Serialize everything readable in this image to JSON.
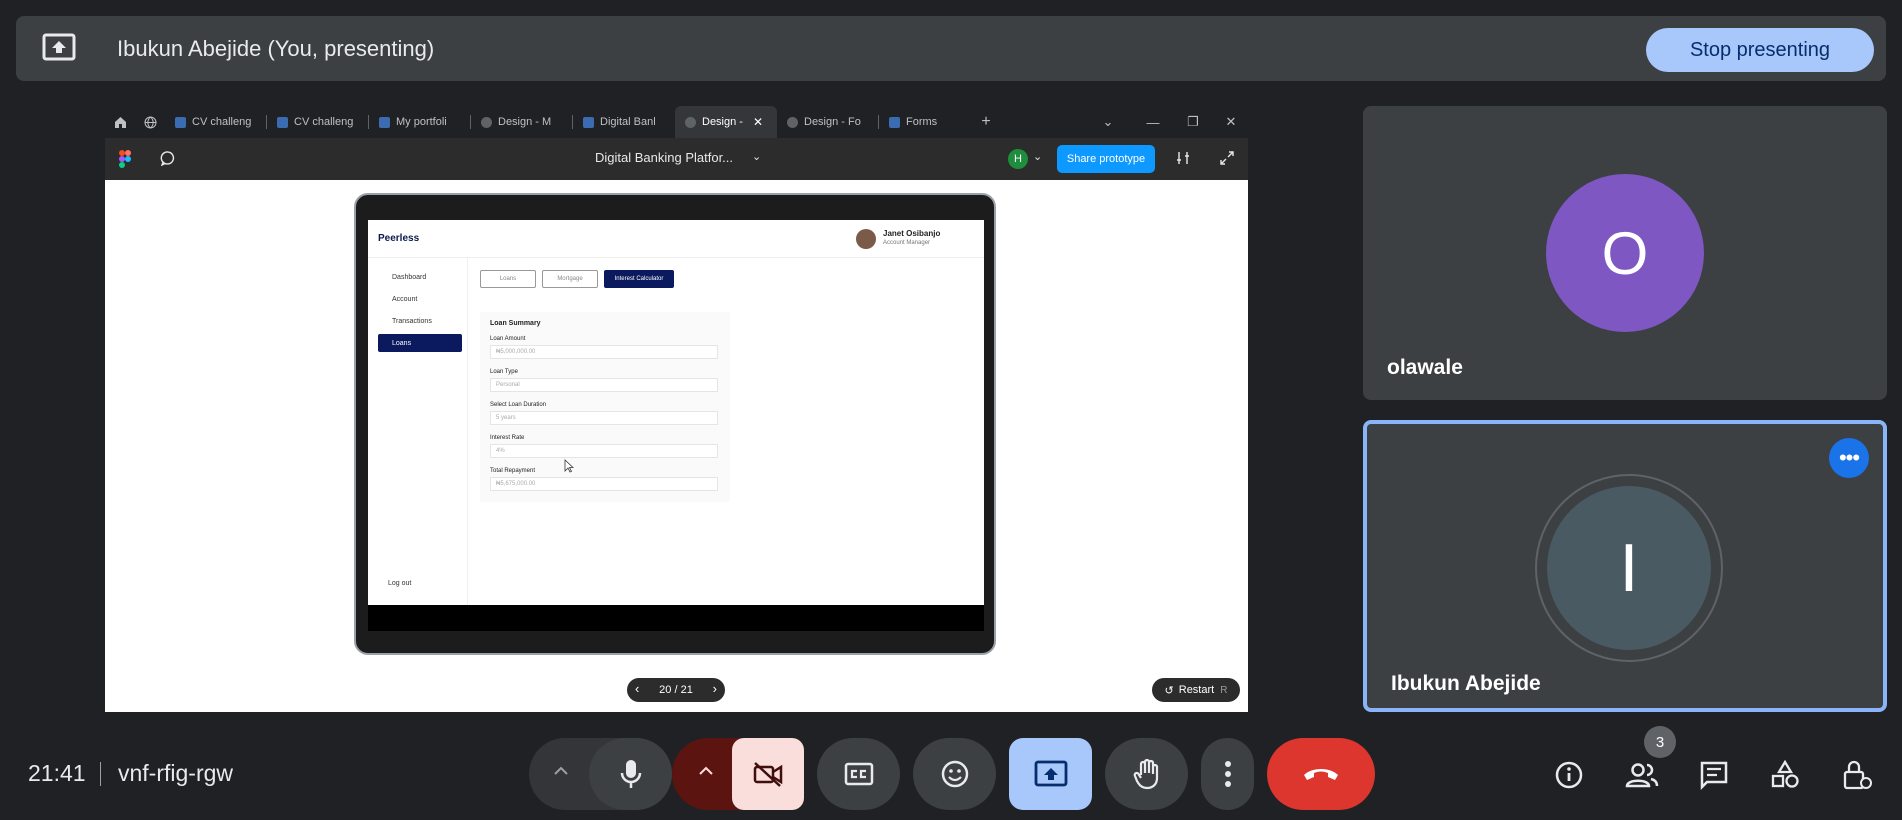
{
  "presenting": {
    "name": "Ibukun Abejide (You, presenting)",
    "stop_label": "Stop presenting"
  },
  "browser": {
    "tabs": [
      {
        "label": "CV challeng",
        "icon": "figma-icon"
      },
      {
        "label": "CV challeng",
        "icon": "figma-icon"
      },
      {
        "label": "My portfoli",
        "icon": "figma-icon"
      },
      {
        "label": "Design - M",
        "icon": "play-icon"
      },
      {
        "label": "Digital Banl",
        "icon": "figma-icon"
      },
      {
        "label": "Design -",
        "icon": "play-icon",
        "active": true
      },
      {
        "label": "Design - Fo",
        "icon": "play-icon"
      },
      {
        "label": "Forms",
        "icon": "figma-icon"
      }
    ],
    "new_tab": "+"
  },
  "figma": {
    "file_title": "Digital Banking Platfor...",
    "avatar_letter": "H",
    "share_label": "Share prototype",
    "page_indicator": "20 / 21",
    "restart_label": "Restart",
    "restart_key": "R"
  },
  "app": {
    "brand": "Peerless",
    "user_name": "Janet Osibanjo",
    "user_role": "Account Manager",
    "nav": [
      "Dashboard",
      "Account",
      "Transactions",
      "Loans"
    ],
    "logout": "Log out",
    "tabs": [
      "Loans",
      "Mortgage",
      "Interest Calculator"
    ],
    "card_title": "Loan Summary",
    "fields": [
      {
        "label": "Loan Amount",
        "value": "₦5,000,000.00"
      },
      {
        "label": "Loan Type",
        "value": "Personal"
      },
      {
        "label": "Select Loan Duration",
        "value": "5 years"
      },
      {
        "label": "Interest Rate",
        "value": "4%"
      },
      {
        "label": "Total Repayment",
        "value": "₦5,675,000.00"
      }
    ]
  },
  "participants": [
    {
      "name": "olawale",
      "initial": "O",
      "color": "#7e57c2"
    },
    {
      "name": "Ibukun Abejide",
      "initial": "I",
      "color": "#4a5a63"
    }
  ],
  "bottom": {
    "time": "21:41",
    "meeting_code": "vnf-rfig-rgw",
    "people_count": "3"
  }
}
